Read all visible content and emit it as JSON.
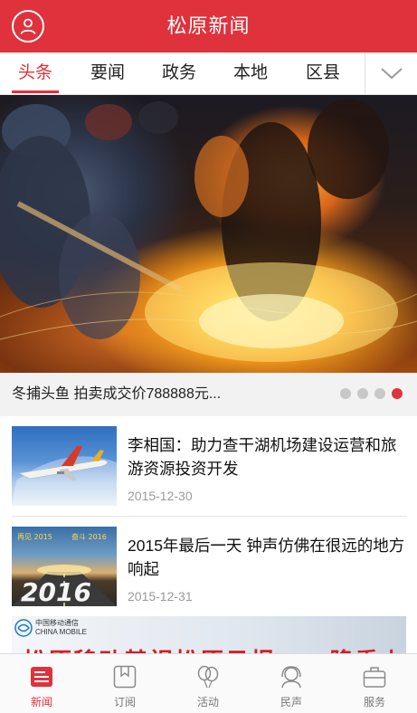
{
  "header": {
    "title": "松原新闻",
    "avatar_icon": "user-icon"
  },
  "tabs": {
    "items": [
      {
        "label": "头条",
        "active": true
      },
      {
        "label": "要闻",
        "active": false
      },
      {
        "label": "政务",
        "active": false
      },
      {
        "label": "本地",
        "active": false
      },
      {
        "label": "区县",
        "active": false
      }
    ],
    "more_icon": "chevron-down-icon"
  },
  "carousel": {
    "caption": "冬捕头鱼  拍卖成交价788888元...",
    "total_slides": 4,
    "active_index": 3
  },
  "news": [
    {
      "title": "李相国：助力查干湖机场建设运营和旅游资源投资开发",
      "date": "2015-12-30"
    },
    {
      "title": "2015年最后一天 钟声仿佛在很远的地方响起",
      "date": "2015-12-31",
      "thumb_text": {
        "left": "再见 2015",
        "right": "奋斗 2016",
        "big": "2016"
      }
    }
  ],
  "banner": {
    "logo_text_cn": "中国移动通信",
    "logo_text_en": "CHINA MOBILE",
    "headline": "松原移动基视松原日报APP隆重上线"
  },
  "bottom_nav": [
    {
      "label": "新闻",
      "icon": "news-icon",
      "active": true
    },
    {
      "label": "订阅",
      "icon": "bookmark-icon",
      "active": false
    },
    {
      "label": "活动",
      "icon": "balloon-icon",
      "active": false
    },
    {
      "label": "民声",
      "icon": "headset-icon",
      "active": false
    },
    {
      "label": "服务",
      "icon": "briefcase-icon",
      "active": false
    }
  ],
  "colors": {
    "brand": "#e0323c",
    "inactive_text": "#777777",
    "date_text": "#9a9a9a"
  }
}
